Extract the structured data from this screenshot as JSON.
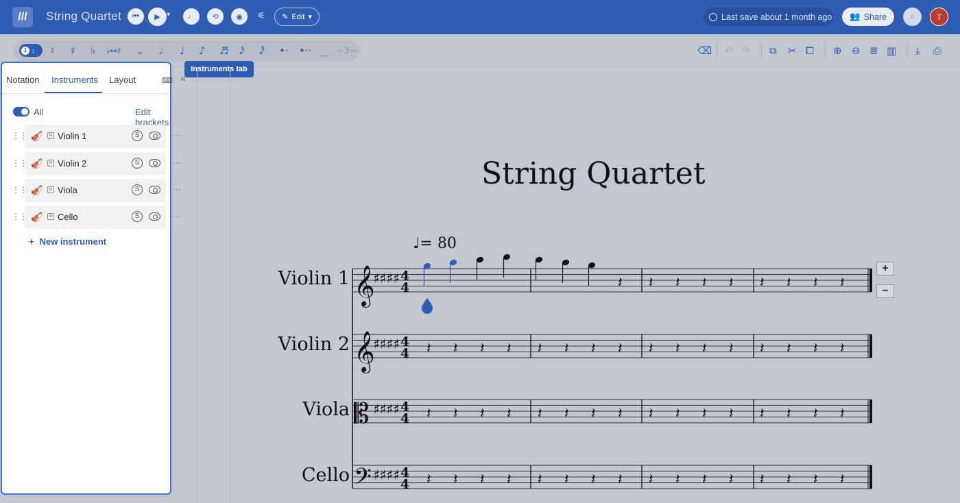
{
  "header": {
    "title": "String Quartet",
    "edit_label": "Edit",
    "last_save": "Last save about 1 month ago",
    "share_label": "Share",
    "avatar_initial": "T"
  },
  "toolbar": {
    "voice_number": "1"
  },
  "sidebar": {
    "tabs": [
      {
        "label": "Notation"
      },
      {
        "label": "Instruments"
      },
      {
        "label": "Layout"
      }
    ],
    "active_tab": "Instruments",
    "all_label": "All",
    "edit_brackets": "Edit brackets",
    "instruments": [
      {
        "name": "Violin 1"
      },
      {
        "name": "Violin 2"
      },
      {
        "name": "Viola"
      },
      {
        "name": "Cello"
      }
    ],
    "new_instrument": "New instrument"
  },
  "tooltip": "Instruments tab",
  "score": {
    "title": "String Quartet",
    "tempo": "= 80",
    "staves": [
      {
        "label": "Violin 1"
      },
      {
        "label": "Violin 2"
      },
      {
        "label": "Viola"
      },
      {
        "label": "Cello"
      }
    ]
  },
  "colors": {
    "brand": "#2f5db3",
    "page_bg": "#c3c7d0"
  }
}
